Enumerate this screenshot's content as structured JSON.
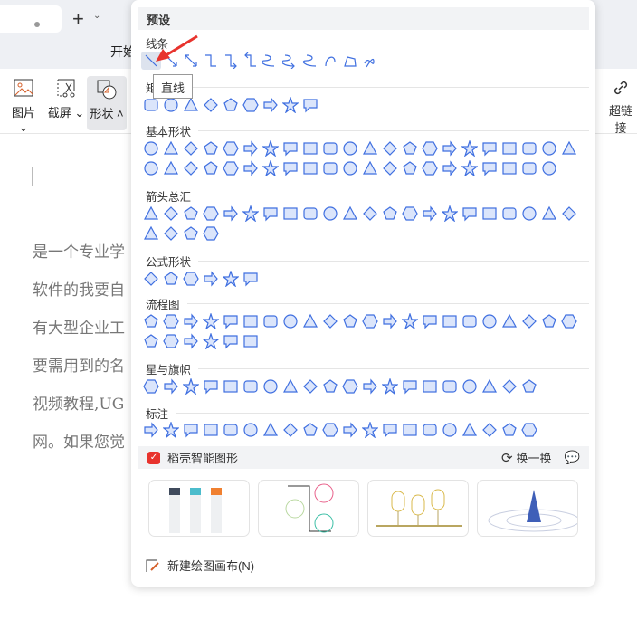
{
  "tabbar": {
    "new_tab": "+",
    "dropdown": "⌄"
  },
  "menu": {
    "start": "开始"
  },
  "toolbar": {
    "picture": "图片",
    "screenshot": "截屏",
    "shapes": "形状",
    "hyperlink": "超链接"
  },
  "document": {
    "lines": [
      "是一个专业学",
      "软件的我要自",
      "有大型企业工",
      "要需用到的名",
      "视频教程,UG",
      "网。如果您觉"
    ]
  },
  "panel": {
    "preset": "预设",
    "tooltip": "直线",
    "sections": [
      {
        "label": "线条",
        "rows": [
          [
            "line",
            "arrow-line",
            "double-arrow-line",
            "elbow-connector",
            "elbow-arrow-connector",
            "elbow-double-arrow-connector",
            "curved-connector",
            "curved-arrow-connector",
            "curved-double-arrow-connector",
            "curve",
            "freeform",
            "scribble"
          ]
        ]
      },
      {
        "label": "矩形",
        "rows": [
          [
            "rect",
            "round-rect",
            "snip-rect",
            "snip2-rect",
            "snip-diag-rect",
            "snip-round-rect",
            "round1-rect",
            "round2-rect",
            "round-diag-rect"
          ]
        ]
      },
      {
        "label": "基本形状",
        "rows": [
          [
            "text-box",
            "vertical-text-box",
            "ellipse",
            "triangle",
            "right-triangle",
            "parallelogram",
            "trapezoid",
            "diamond",
            "pentagon",
            "hexagon",
            "heptagon",
            "octagon",
            "decagon",
            "dodecagon",
            "pie",
            "chord",
            "teardrop",
            "frame",
            "half-frame",
            "corner",
            "diagonal-stripe",
            "cross"
          ],
          [
            "plaque",
            "can",
            "cube",
            "bevel",
            "donut",
            "no-symbol",
            "block-arc",
            "folded-corner",
            "smiley",
            "heart",
            "lightning",
            "sun",
            "moon",
            "cloud",
            "arc",
            "double-bracket",
            "double-brace",
            "left-bracket",
            "right-bracket",
            "left-brace",
            "right-brace"
          ]
        ]
      },
      {
        "label": "箭头总汇",
        "rows": [
          [
            "right-arrow",
            "left-arrow",
            "up-arrow",
            "down-arrow",
            "left-right-arrow",
            "up-down-arrow",
            "quad-arrow",
            "left-right-up-arrow",
            "bent-arrow",
            "u-turn-arrow",
            "left-up-arrow",
            "bent-up-arrow",
            "curved-right-arrow",
            "curved-left-arrow",
            "curved-up-arrow",
            "curved-down-arrow",
            "striped-right-arrow",
            "notched-right-arrow",
            "pentagon-arrow",
            "chevron",
            "right-arrow-callout",
            "left-arrow-callout"
          ],
          [
            "up-arrow-callout",
            "down-arrow-callout",
            "quad-arrow-callout",
            "circular-arrow"
          ]
        ]
      },
      {
        "label": "公式形状",
        "rows": [
          [
            "plus",
            "minus",
            "multiply",
            "divide",
            "equal",
            "not-equal"
          ]
        ]
      },
      {
        "label": "流程图",
        "rows": [
          [
            "process",
            "alternate-process",
            "decision",
            "data",
            "predefined-process",
            "internal-storage",
            "document",
            "multidocument",
            "terminator",
            "preparation",
            "manual-input",
            "manual-operation",
            "connector",
            "off-page-connector",
            "card",
            "punched-tape",
            "summing-junction",
            "or",
            "collate",
            "sort",
            "extract",
            "merge"
          ],
          [
            "stored-data",
            "delay",
            "sequential-storage",
            "magnetic-disk",
            "direct-access-storage",
            "display"
          ]
        ]
      },
      {
        "label": "星与旗帜",
        "rows": [
          [
            "explosion1",
            "explosion2",
            "star4",
            "star5",
            "star6",
            "star7",
            "star8",
            "star10",
            "star12",
            "star16",
            "star24",
            "star32",
            "ribbon-up",
            "ribbon-down",
            "curved-ribbon-up",
            "curved-ribbon-down",
            "vertical-scroll",
            "horizontal-scroll",
            "wave",
            "double-wave"
          ]
        ]
      },
      {
        "label": "标注",
        "rows": [
          [
            "rect-callout",
            "round-rect-callout",
            "oval-callout",
            "cloud-callout",
            "line-callout1",
            "line-callout2",
            "line-callout3",
            "line-callout4",
            "accent-callout1",
            "accent-callout2",
            "accent-callout3",
            "accent-callout4",
            "no-border-callout1",
            "no-border-callout2",
            "no-border-callout3",
            "no-border-callout4",
            "accent-border-callout1",
            "accent-border-callout2",
            "accent-border-callout3",
            "accent-border-callout4"
          ]
        ]
      }
    ],
    "ai": {
      "title": "稻壳智能图形",
      "refresh": "换一换"
    },
    "new_canvas": "新建绘图画布(N)"
  },
  "colors": {
    "shape_stroke": "#3f6fe0",
    "shape_fill": "#dbe5fb",
    "accent": "#e8332d"
  }
}
